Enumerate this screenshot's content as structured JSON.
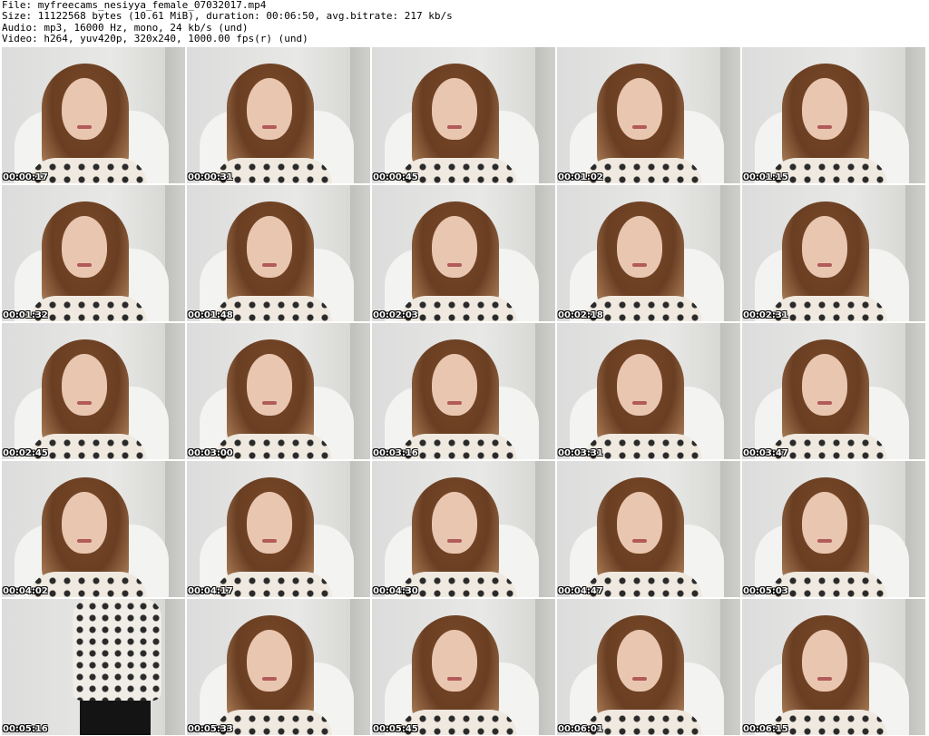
{
  "header": {
    "file": "File: myfreecams_nesiyya_female_07032017.mp4",
    "size": "Size: 11122568 bytes (10.61 MiB), duration: 00:06:50, avg.bitrate: 217 kb/s",
    "audio": "Audio: mp3, 16000 Hz, mono, 24 kb/s (und)",
    "video": "Video: h264, yuv420p, 320x240, 1000.00 fps(r) (und)"
  },
  "thumbnails": [
    {
      "time": "00:00:17"
    },
    {
      "time": "00:00:31"
    },
    {
      "time": "00:00:45"
    },
    {
      "time": "00:01:02"
    },
    {
      "time": "00:01:15"
    },
    {
      "time": "00:01:32"
    },
    {
      "time": "00:01:48"
    },
    {
      "time": "00:02:03"
    },
    {
      "time": "00:02:18"
    },
    {
      "time": "00:02:31"
    },
    {
      "time": "00:02:45"
    },
    {
      "time": "00:03:00"
    },
    {
      "time": "00:03:16"
    },
    {
      "time": "00:03:31"
    },
    {
      "time": "00:03:47"
    },
    {
      "time": "00:04:02"
    },
    {
      "time": "00:04:17"
    },
    {
      "time": "00:04:30"
    },
    {
      "time": "00:04:47"
    },
    {
      "time": "00:05:03"
    },
    {
      "time": "00:05:16"
    },
    {
      "time": "00:05:33"
    },
    {
      "time": "00:05:45"
    },
    {
      "time": "00:06:01"
    },
    {
      "time": "00:06:15"
    }
  ]
}
